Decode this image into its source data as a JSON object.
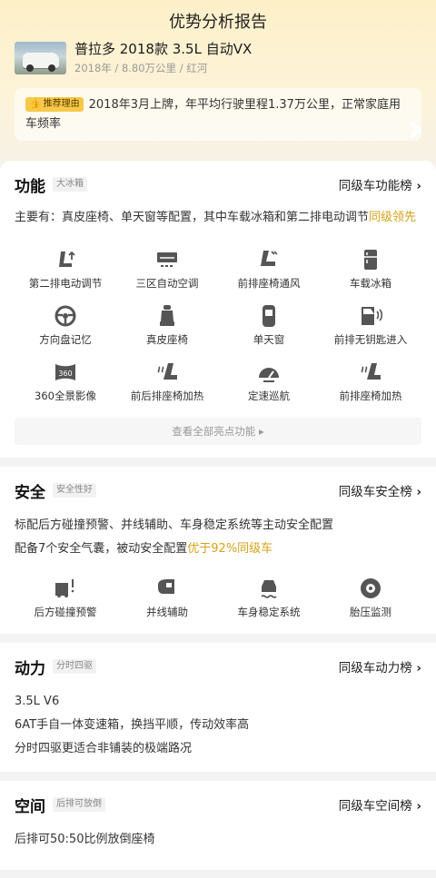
{
  "page_title": "优势分析报告",
  "car": {
    "name": "普拉多 2018款 3.5L 自动VX",
    "meta": "2018年 / 8.80万公里 / 红河"
  },
  "reason": {
    "tag": "推荐理由",
    "text": "2018年3月上牌，年平均行驶里程1.37万公里，正常家庭用车频率"
  },
  "function": {
    "title": "功能",
    "tag": "大冰箱",
    "link": "同级车功能榜",
    "desc_main": "主要有：真皮座椅、单天窗等配置，其中车载冰箱和第二排电动调节",
    "desc_hl": "同级领先",
    "features": [
      {
        "label": "第二排电动调节",
        "icon": "seat-adjust-icon"
      },
      {
        "label": "三区自动空调",
        "icon": "ac-icon"
      },
      {
        "label": "前排座椅通风",
        "icon": "seat-vent-icon"
      },
      {
        "label": "车载冰箱",
        "icon": "fridge-icon"
      },
      {
        "label": "方向盘记忆",
        "icon": "steering-wheel-icon"
      },
      {
        "label": "真皮座椅",
        "icon": "leather-seat-icon"
      },
      {
        "label": "单天窗",
        "icon": "sunroof-icon"
      },
      {
        "label": "前排无钥匙进入",
        "icon": "keyless-entry-icon"
      },
      {
        "label": "360全景影像",
        "icon": "camera-360-icon"
      },
      {
        "label": "前后排座椅加热",
        "icon": "seat-heat-icon"
      },
      {
        "label": "定速巡航",
        "icon": "cruise-icon"
      },
      {
        "label": "前排座椅加热",
        "icon": "front-seat-heat-icon"
      }
    ],
    "view_all": "查看全部亮点功能"
  },
  "safety": {
    "title": "安全",
    "tag": "安全性好",
    "link": "同级车安全榜",
    "line1": "标配后方碰撞预警、并线辅助、车身稳定系统等主动安全配置",
    "line2_main": "配备7个安全气囊，被动安全配置",
    "line2_hl": "优于92%同级车",
    "features": [
      {
        "label": "后方碰撞预警",
        "icon": "rear-warning-icon"
      },
      {
        "label": "并线辅助",
        "icon": "lane-assist-icon"
      },
      {
        "label": "车身稳定系统",
        "icon": "stability-icon"
      },
      {
        "label": "胎压监测",
        "icon": "tire-pressure-icon"
      }
    ]
  },
  "power": {
    "title": "动力",
    "tag": "分时四驱",
    "link": "同级车动力榜",
    "lines": [
      "3.5L V6",
      "6AT手自一体变速箱，换挡平顺，传动效率高",
      "分时四驱更适合非铺装的极端路况"
    ]
  },
  "space": {
    "title": "空间",
    "tag": "后排可放倒",
    "link": "同级车空间榜",
    "lines": [
      "后排可50:50比例放倒座椅"
    ]
  }
}
